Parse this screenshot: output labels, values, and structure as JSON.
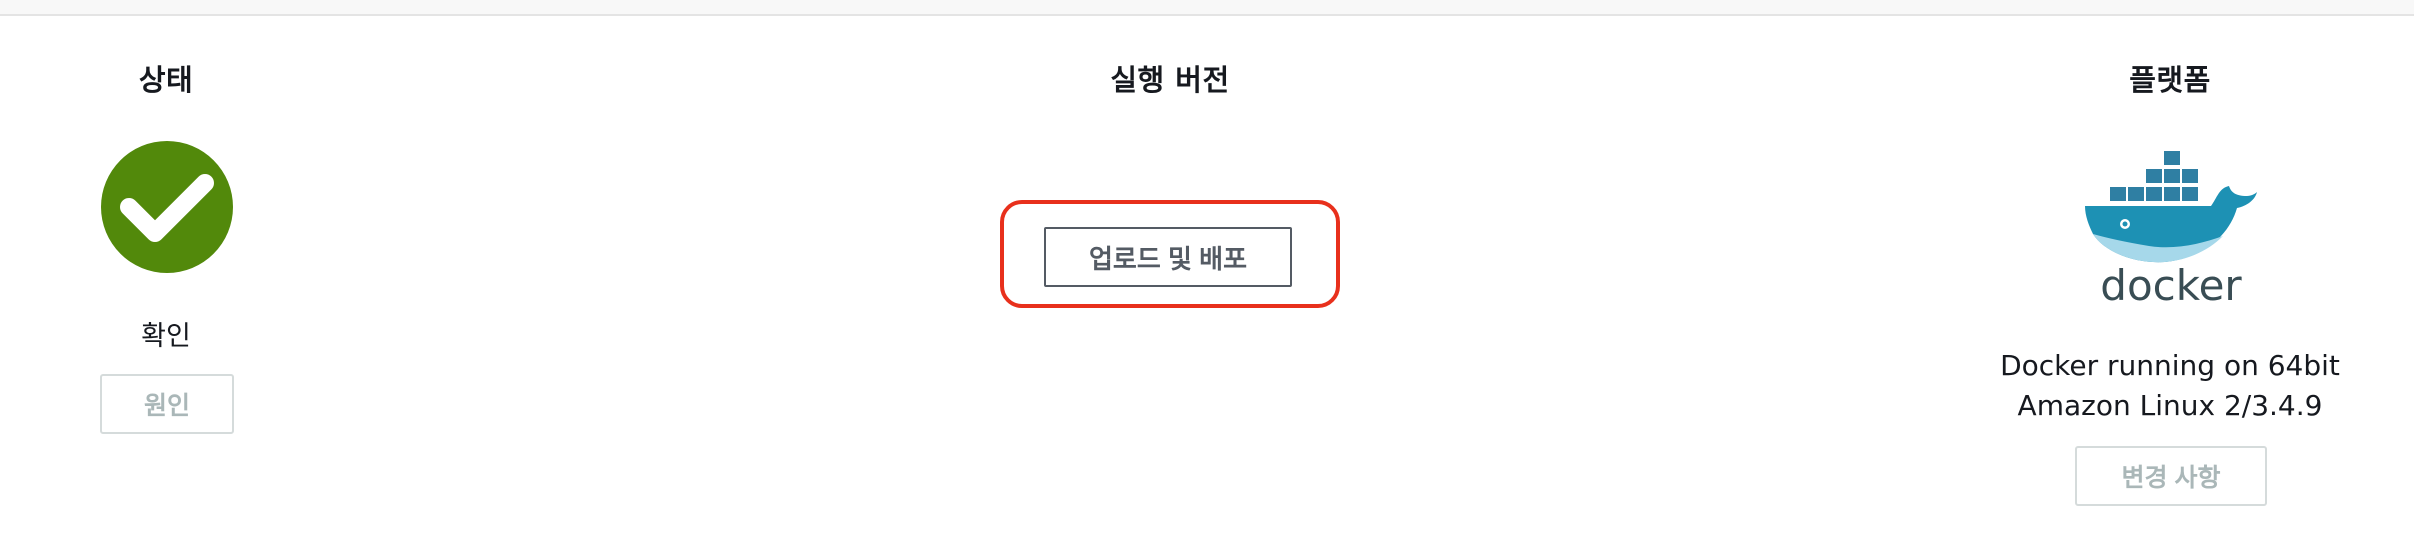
{
  "status": {
    "title": "상태",
    "health_text": "확인",
    "cause_button": "원인",
    "health_color": "#52890b",
    "icon": "check-circle-icon"
  },
  "version": {
    "title": "실행 버전",
    "upload_button": "업로드 및 배포",
    "highlight_color": "#e8301c"
  },
  "platform": {
    "title": "플랫폼",
    "logo_text": "docker",
    "description": "Docker running on 64bit Amazon Linux 2/3.4.9",
    "change_button": "변경 사항",
    "brand_color": "#1d91b4",
    "logo_text_color": "#394d54"
  }
}
